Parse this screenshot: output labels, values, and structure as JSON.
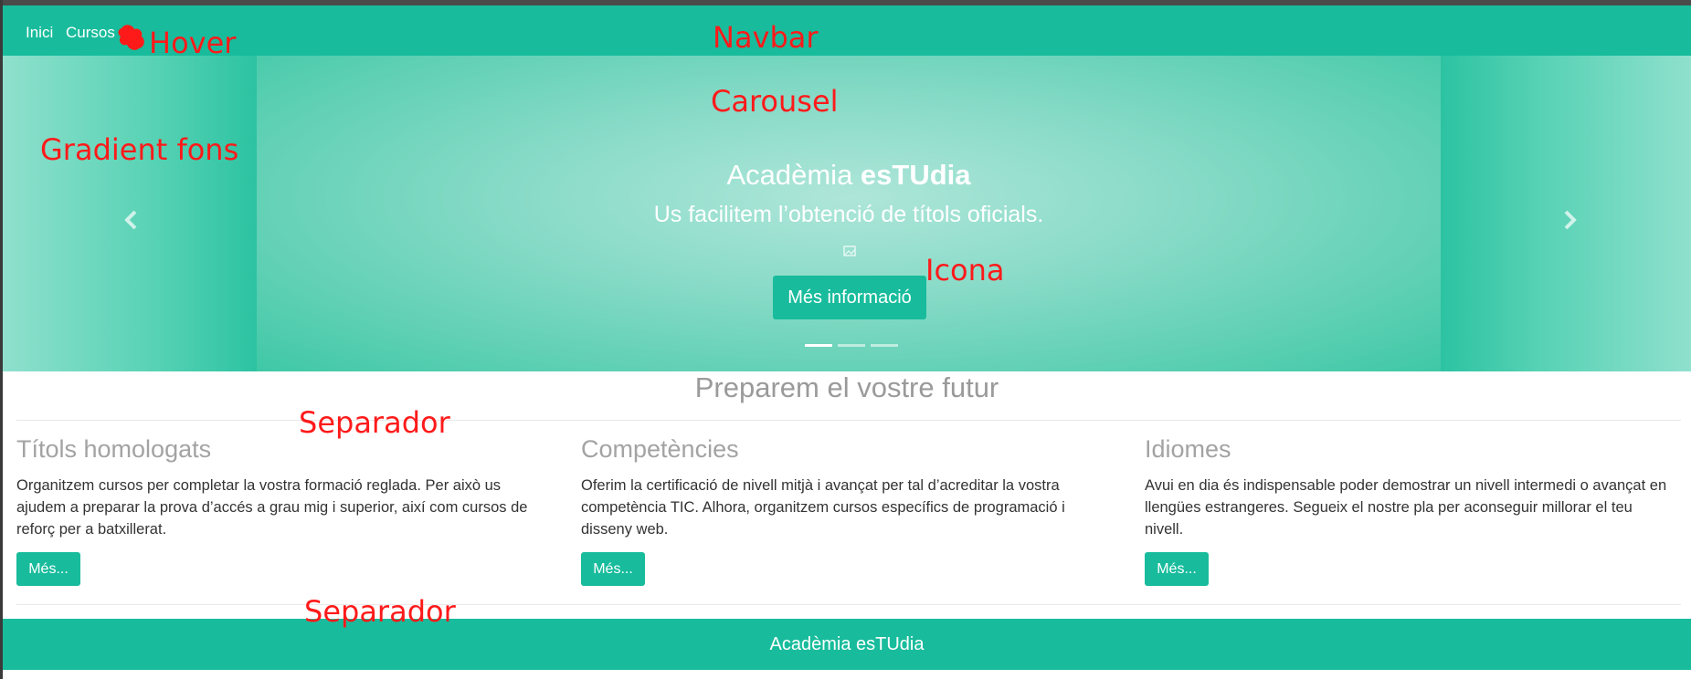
{
  "colors": {
    "primary": "#18bc9c",
    "heading_grey": "#9a9a9a",
    "annotation_red": "#ff1a1a"
  },
  "navbar": {
    "links": [
      {
        "label": "Inici"
      },
      {
        "label": "Cursos"
      }
    ]
  },
  "carousel": {
    "title_prefix": "Acadèmia ",
    "title_brand": "esTUdia",
    "subtitle": "Us facilitem l’obtenció de títols oficials.",
    "button_label": "Més informació",
    "indicators": 3,
    "active_indicator": 0,
    "icons": {
      "prev": "chevron-left-icon",
      "next": "chevron-right-icon",
      "small": "broken-image-icon"
    }
  },
  "section": {
    "title": "Preparem el vostre futur",
    "columns": [
      {
        "title": "Títols homologats",
        "text": "Organitzem cursos per completar la vostra formació reglada. Per això us ajudem a preparar la prova d’accés a grau mig i superior, així com cursos de reforç per a batxillerat.",
        "button": "Més..."
      },
      {
        "title": "Competències",
        "text": "Oferim la certificació de nivell mitjà i avançat per tal d’acreditar la vostra competència TIC. Alhora, organitzem cursos específics de programació i disseny web.",
        "button": "Més..."
      },
      {
        "title": "Idiomes",
        "text": "Avui en dia és indispensable poder demostrar un nivell intermedi o avançat en llengües estrangeres. Segueix el nostre pla per aconseguir millorar el teu nivell.",
        "button": "Més..."
      }
    ]
  },
  "footer": {
    "text": "Acadèmia esTUdia"
  },
  "annotations": {
    "hover": "Hover",
    "navbar": "Navbar",
    "carousel": "Carousel",
    "gradient": "Gradient fons",
    "icona": "Icona",
    "separador_1": "Separador",
    "separador_2": "Separador"
  }
}
